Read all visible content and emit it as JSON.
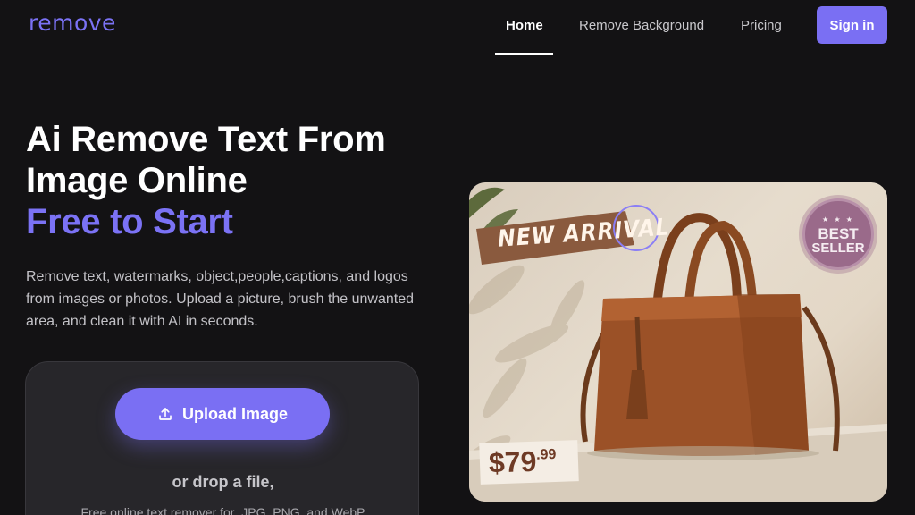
{
  "header": {
    "logo": "remove",
    "nav": [
      {
        "label": "Home"
      },
      {
        "label": "Remove Background"
      },
      {
        "label": "Pricing"
      }
    ],
    "signin_label": "Sign in"
  },
  "hero": {
    "title_line1": "Ai Remove Text From",
    "title_line2": "Image Online",
    "title_accent": "Free to Start",
    "description": "Remove text, watermarks, object,people,captions, and logos from images or photos. Upload a picture, brush the unwanted area, and clean it with AI in seconds."
  },
  "upload": {
    "button_label": "Upload Image",
    "button_icon": "upload-icon",
    "drop_text": "or drop a file,",
    "formats_text": "Free online text remover for .JPG, PNG, and WebP"
  },
  "product_image": {
    "banner_text": "NEW ARRIVAL",
    "badge_line1": "BEST",
    "badge_line2": "SELLER",
    "badge_stars": "★ ★ ★",
    "price_main": "$79",
    "price_cents": ".99"
  },
  "colors": {
    "accent": "#7a6ff3",
    "background": "#131214",
    "card": "#27262a"
  }
}
